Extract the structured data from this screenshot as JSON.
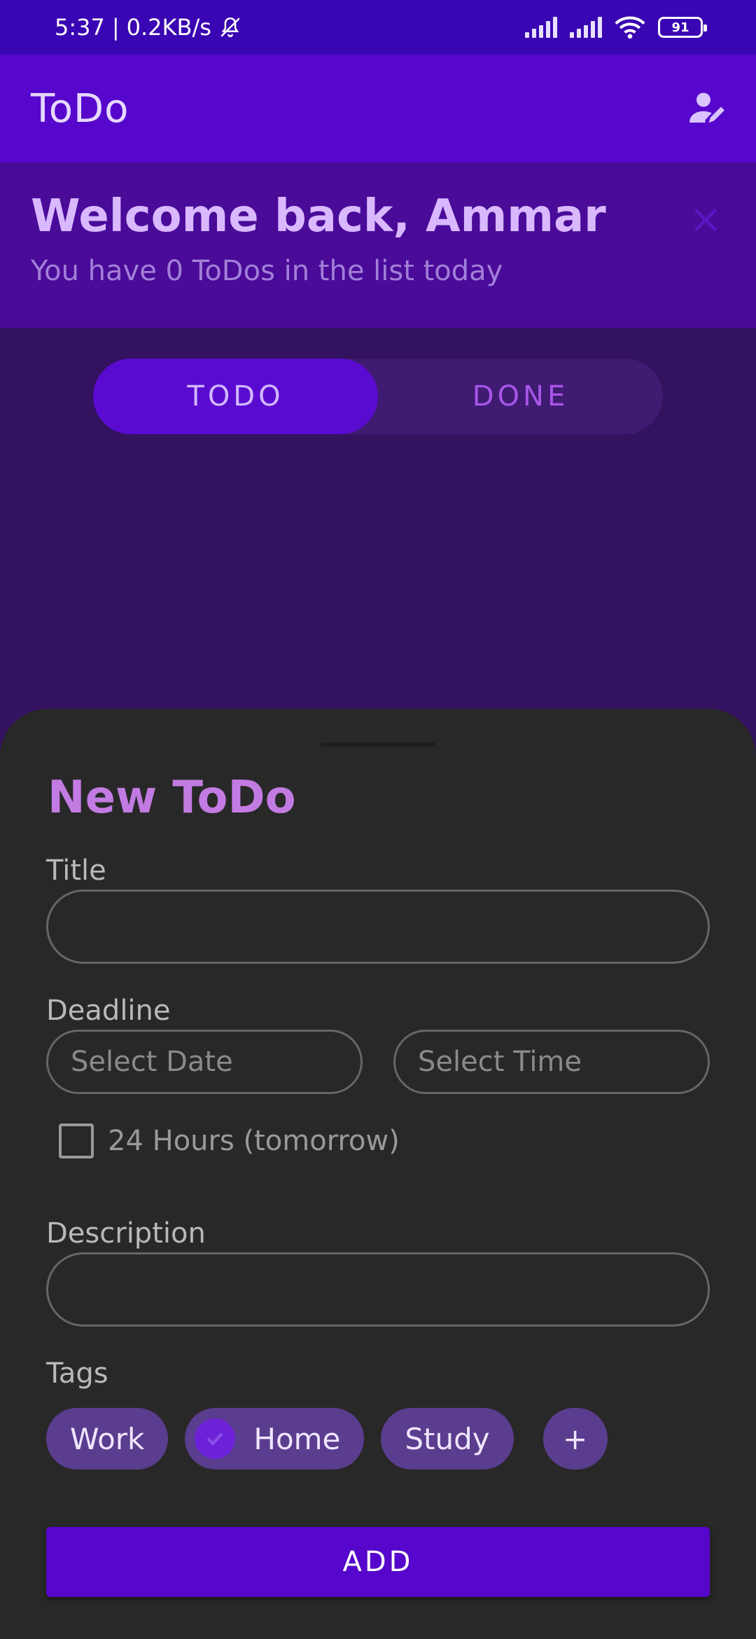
{
  "status_bar": {
    "time": "5:37",
    "network_speed": "0.2KB/s",
    "battery": "91"
  },
  "app_bar": {
    "title": "ToDo",
    "profile_icon": "person-edit-icon"
  },
  "welcome": {
    "title": "Welcome back, Ammar",
    "subtitle": "You have 0 ToDos in the list today",
    "close_icon": "close-icon"
  },
  "tabs": [
    {
      "label": "TODO",
      "active": true
    },
    {
      "label": "DONE",
      "active": false
    }
  ],
  "sheet": {
    "title": "New ToDo",
    "title_label": "Title",
    "title_value": "",
    "deadline_label": "Deadline",
    "date_placeholder": "Select Date",
    "time_placeholder": "Select Time",
    "checkbox_label": "24 Hours (tomorrow)",
    "description_label": "Description",
    "description_value": "",
    "tags_label": "Tags",
    "tags": [
      {
        "label": "Work",
        "selected": false
      },
      {
        "label": "Home",
        "selected": true
      },
      {
        "label": "Study",
        "selected": false
      }
    ],
    "add_tag_label": "+",
    "add_button_label": "ADD"
  },
  "colors": {
    "status_bar": "#3a05b2",
    "app_bar": "#5607cb",
    "banner": "#4a0b98",
    "background": "#33125f",
    "sheet": "#282828",
    "accent": "#c27be2",
    "chip": "#5a3d8e"
  }
}
